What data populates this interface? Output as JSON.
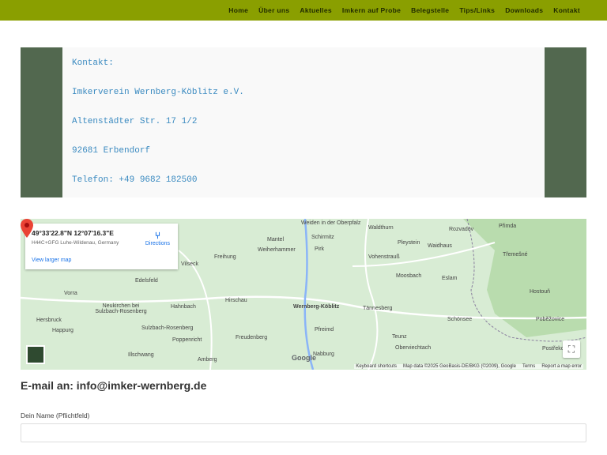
{
  "nav": [
    "Home",
    "Über uns",
    "Aktuelles",
    "Imkern auf Probe",
    "Belegstelle",
    "Tips/Links",
    "Downloads",
    "Kontakt"
  ],
  "contact": [
    "Kontakt:",
    "Imkerverein Wernberg-Köblitz e.V.",
    "Altenstädter Str. 17 1/2",
    "92681 Erbendorf",
    "Telefon: +49 9682 182500"
  ],
  "map": {
    "coords": "49°33'22.8\"N 12°07'16.3\"E",
    "plus_code": "H44C+GFG Luhe-Wildenau, Germany",
    "directions": "Directions",
    "larger": "View larger map",
    "logo": "Google",
    "attribution": [
      "Keyboard shortcuts",
      "Map data ©2025 GeoBasis-DE/BKG (©2009), Google",
      "Terms",
      "Report a map error"
    ],
    "places": [
      "Weiden in der Oberpfalz",
      "Waldthurn",
      "Rozvadov",
      "Přimda",
      "Mantel",
      "Schirmitz",
      "Pleystein",
      "Waidhaus",
      "Weiherhammer",
      "Pirk",
      "Vohenstrauß",
      "Třemešné",
      "Freihung",
      "Vilseck",
      "Moosbach",
      "Eslam",
      "Edelsfeld",
      "Vorra",
      "Hirschau",
      "Wernberg-Köblitz",
      "Tännesberg",
      "Hahnbach",
      "Neukirchen bei Sulzbach-Rosenberg",
      "Hersbruck",
      "Sulzbach-Rosenberg",
      "Schönsee",
      "Happurg",
      "Pfreimd",
      "Teunz",
      "Poppenricht",
      "Freudenberg",
      "Oberviechtach",
      "Illschwang",
      "Amberg",
      "Nabburg",
      "Hostouň",
      "Poběžovice",
      "Postřekov"
    ]
  },
  "form": {
    "heading": "E-mail an: info@imker-wernberg.de",
    "name_label": "Dein Name (Pflichtfeld)",
    "name_value": ""
  }
}
